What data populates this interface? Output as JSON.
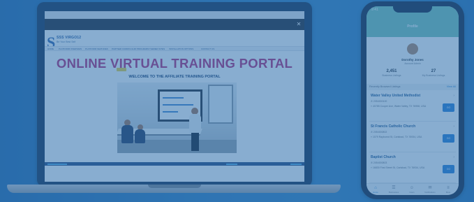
{
  "laptop": {
    "site": {
      "logo_title": "SSS VIRGO12",
      "logo_subtitle": "Be Your Best Self",
      "nav": [
        "HOME",
        "PLATFORM OVERVIEW",
        "PLATFORM FEATURES",
        "PARTNER CURRICULUM PROGRAMS",
        "THEMED SITES",
        "INSTALLATION OPTIONS",
        "CONTACT US"
      ],
      "hero_title": "ONLINE VIRTUAL TRAINING PORTAL",
      "welcome_text": "WELCOME TO THE AFFILIATE TRAINING PORTAL"
    }
  },
  "phone": {
    "status_time": "9:41",
    "header_title": "Profile",
    "user_name": "Dorothy Jones",
    "user_role": "Account Admin",
    "stats": [
      {
        "value": "2,451",
        "label": "Business Listings"
      },
      {
        "value": "27",
        "label": "My Business Listings"
      }
    ],
    "section_title": "Recently Browsed Listings",
    "section_link": "View All",
    "listings": [
      {
        "name": "Water Valley United Methodist",
        "phone": "2054000100",
        "address": "40785 Cooper Ave, Water Valley, TX 76958, USA",
        "button": "GO"
      },
      {
        "name": "St Francis Catholic Church",
        "phone": "2054000802",
        "address": "1079 Rayburnd St, Carlsbad, TX 76934, USA",
        "button": "GO"
      },
      {
        "name": "Baptist Church",
        "phone": "2054000803",
        "address": "16830 First Street St, Carlsbad, TX 76934, USA",
        "button": "GO"
      }
    ],
    "tabs": [
      {
        "icon": "⌂",
        "label": "Home"
      },
      {
        "icon": "☰",
        "label": "Businesses"
      },
      {
        "icon": "☺",
        "label": "Users"
      },
      {
        "icon": "✉",
        "label": "Notifications"
      },
      {
        "icon": "≡",
        "label": "More"
      }
    ]
  }
}
